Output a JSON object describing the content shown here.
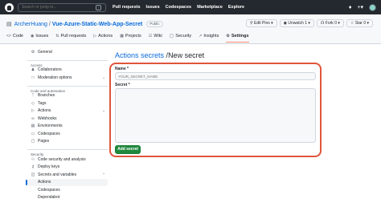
{
  "topbar": {
    "search_placeholder": "Search or jump to...",
    "slash_key": "/",
    "nav": [
      "Pull requests",
      "Issues",
      "Codespaces",
      "Marketplace",
      "Explore"
    ],
    "bell_icon": "bell-icon",
    "plus_icon": "plus-icon"
  },
  "repo": {
    "owner": "ArcherHuang",
    "separator": "/",
    "name": "Vue-Azure-Static-Web-App-Secret",
    "visibility": "Public",
    "buttons": {
      "edit_pins": "Edit Pins",
      "unwatch": "Unwatch",
      "unwatch_count": "1",
      "fork": "Fork",
      "fork_count": "0",
      "star": "Star",
      "star_count": "0"
    }
  },
  "tabs": [
    "Code",
    "Issues",
    "Pull requests",
    "Actions",
    "Projects",
    "Wiki",
    "Security",
    "Insights",
    "Settings"
  ],
  "sidebar": {
    "general": "General",
    "access_heading": "Access",
    "collaborators": "Collaborators",
    "moderation": "Moderation options",
    "code_heading": "Code and automation",
    "branches": "Branches",
    "tags": "Tags",
    "actions": "Actions",
    "webhooks": "Webhooks",
    "environments": "Environments",
    "codespaces": "Codespaces",
    "pages": "Pages",
    "security_heading": "Security",
    "code_security": "Code security and analysis",
    "deploy_keys": "Deploy keys",
    "secrets": "Secrets and variables",
    "sub_actions": "Actions",
    "sub_codespaces": "Codespaces",
    "sub_dependabot": "Dependabot"
  },
  "main": {
    "breadcrumb_link": "Actions secrets",
    "breadcrumb_sep": "/",
    "breadcrumb_current": "New secret",
    "name_label": "Name *",
    "name_placeholder": "YOUR_SECRET_NAME",
    "secret_label": "Secret *",
    "secret_value": "",
    "add_button": "Add secret"
  },
  "colors": {
    "topbar": "#24292f",
    "link": "#0969da",
    "primary_button": "#1f883d",
    "highlight": "#e0553b",
    "active_tab": "#fd8c73"
  }
}
